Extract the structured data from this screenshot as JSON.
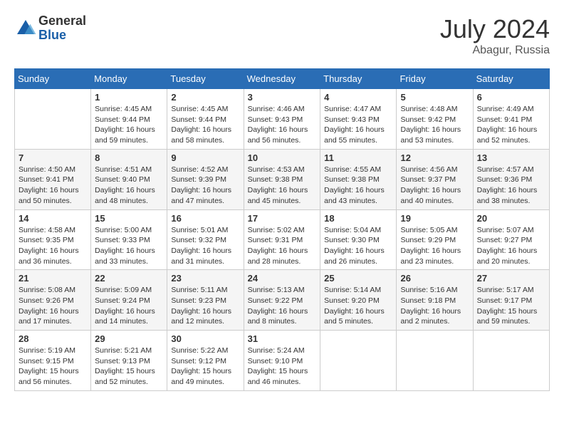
{
  "header": {
    "logo_general": "General",
    "logo_blue": "Blue",
    "month_year": "July 2024",
    "location": "Abagur, Russia"
  },
  "calendar": {
    "days_of_week": [
      "Sunday",
      "Monday",
      "Tuesday",
      "Wednesday",
      "Thursday",
      "Friday",
      "Saturday"
    ],
    "weeks": [
      [
        {
          "day": "",
          "info": ""
        },
        {
          "day": "1",
          "info": "Sunrise: 4:45 AM\nSunset: 9:44 PM\nDaylight: 16 hours\nand 59 minutes."
        },
        {
          "day": "2",
          "info": "Sunrise: 4:45 AM\nSunset: 9:44 PM\nDaylight: 16 hours\nand 58 minutes."
        },
        {
          "day": "3",
          "info": "Sunrise: 4:46 AM\nSunset: 9:43 PM\nDaylight: 16 hours\nand 56 minutes."
        },
        {
          "day": "4",
          "info": "Sunrise: 4:47 AM\nSunset: 9:43 PM\nDaylight: 16 hours\nand 55 minutes."
        },
        {
          "day": "5",
          "info": "Sunrise: 4:48 AM\nSunset: 9:42 PM\nDaylight: 16 hours\nand 53 minutes."
        },
        {
          "day": "6",
          "info": "Sunrise: 4:49 AM\nSunset: 9:41 PM\nDaylight: 16 hours\nand 52 minutes."
        }
      ],
      [
        {
          "day": "7",
          "info": "Sunrise: 4:50 AM\nSunset: 9:41 PM\nDaylight: 16 hours\nand 50 minutes."
        },
        {
          "day": "8",
          "info": "Sunrise: 4:51 AM\nSunset: 9:40 PM\nDaylight: 16 hours\nand 48 minutes."
        },
        {
          "day": "9",
          "info": "Sunrise: 4:52 AM\nSunset: 9:39 PM\nDaylight: 16 hours\nand 47 minutes."
        },
        {
          "day": "10",
          "info": "Sunrise: 4:53 AM\nSunset: 9:38 PM\nDaylight: 16 hours\nand 45 minutes."
        },
        {
          "day": "11",
          "info": "Sunrise: 4:55 AM\nSunset: 9:38 PM\nDaylight: 16 hours\nand 43 minutes."
        },
        {
          "day": "12",
          "info": "Sunrise: 4:56 AM\nSunset: 9:37 PM\nDaylight: 16 hours\nand 40 minutes."
        },
        {
          "day": "13",
          "info": "Sunrise: 4:57 AM\nSunset: 9:36 PM\nDaylight: 16 hours\nand 38 minutes."
        }
      ],
      [
        {
          "day": "14",
          "info": "Sunrise: 4:58 AM\nSunset: 9:35 PM\nDaylight: 16 hours\nand 36 minutes."
        },
        {
          "day": "15",
          "info": "Sunrise: 5:00 AM\nSunset: 9:33 PM\nDaylight: 16 hours\nand 33 minutes."
        },
        {
          "day": "16",
          "info": "Sunrise: 5:01 AM\nSunset: 9:32 PM\nDaylight: 16 hours\nand 31 minutes."
        },
        {
          "day": "17",
          "info": "Sunrise: 5:02 AM\nSunset: 9:31 PM\nDaylight: 16 hours\nand 28 minutes."
        },
        {
          "day": "18",
          "info": "Sunrise: 5:04 AM\nSunset: 9:30 PM\nDaylight: 16 hours\nand 26 minutes."
        },
        {
          "day": "19",
          "info": "Sunrise: 5:05 AM\nSunset: 9:29 PM\nDaylight: 16 hours\nand 23 minutes."
        },
        {
          "day": "20",
          "info": "Sunrise: 5:07 AM\nSunset: 9:27 PM\nDaylight: 16 hours\nand 20 minutes."
        }
      ],
      [
        {
          "day": "21",
          "info": "Sunrise: 5:08 AM\nSunset: 9:26 PM\nDaylight: 16 hours\nand 17 minutes."
        },
        {
          "day": "22",
          "info": "Sunrise: 5:09 AM\nSunset: 9:24 PM\nDaylight: 16 hours\nand 14 minutes."
        },
        {
          "day": "23",
          "info": "Sunrise: 5:11 AM\nSunset: 9:23 PM\nDaylight: 16 hours\nand 12 minutes."
        },
        {
          "day": "24",
          "info": "Sunrise: 5:13 AM\nSunset: 9:22 PM\nDaylight: 16 hours\nand 8 minutes."
        },
        {
          "day": "25",
          "info": "Sunrise: 5:14 AM\nSunset: 9:20 PM\nDaylight: 16 hours\nand 5 minutes."
        },
        {
          "day": "26",
          "info": "Sunrise: 5:16 AM\nSunset: 9:18 PM\nDaylight: 16 hours\nand 2 minutes."
        },
        {
          "day": "27",
          "info": "Sunrise: 5:17 AM\nSunset: 9:17 PM\nDaylight: 15 hours\nand 59 minutes."
        }
      ],
      [
        {
          "day": "28",
          "info": "Sunrise: 5:19 AM\nSunset: 9:15 PM\nDaylight: 15 hours\nand 56 minutes."
        },
        {
          "day": "29",
          "info": "Sunrise: 5:21 AM\nSunset: 9:13 PM\nDaylight: 15 hours\nand 52 minutes."
        },
        {
          "day": "30",
          "info": "Sunrise: 5:22 AM\nSunset: 9:12 PM\nDaylight: 15 hours\nand 49 minutes."
        },
        {
          "day": "31",
          "info": "Sunrise: 5:24 AM\nSunset: 9:10 PM\nDaylight: 15 hours\nand 46 minutes."
        },
        {
          "day": "",
          "info": ""
        },
        {
          "day": "",
          "info": ""
        },
        {
          "day": "",
          "info": ""
        }
      ]
    ]
  }
}
